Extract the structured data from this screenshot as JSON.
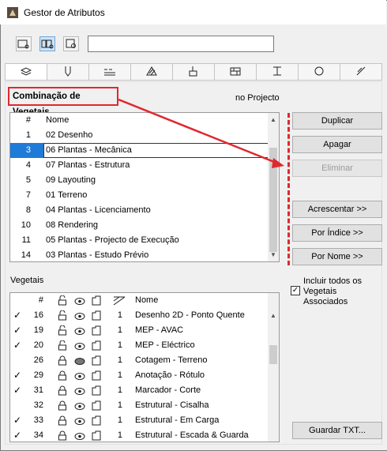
{
  "window": {
    "title": "Gestor de Atributos"
  },
  "toolbar": {
    "search_value": ""
  },
  "tabs": [
    "layers-icon",
    "pen-icon",
    "line-type-icon",
    "fill-icon",
    "paint-icon",
    "building-material-icon",
    "profile-icon",
    "surface-icon",
    "layer-combination-icon"
  ],
  "combination_label": "Combinação de Vegetais",
  "in_project_label": "no Projecto",
  "list1": {
    "headers": {
      "num": "#",
      "name": "Nome"
    },
    "rows": [
      {
        "num": "1",
        "name": "02 Desenho"
      },
      {
        "num": "3",
        "name": "06 Plantas - Mecânica",
        "selected": true
      },
      {
        "num": "4",
        "name": "07 Plantas - Estrutura"
      },
      {
        "num": "5",
        "name": "09 Layouting"
      },
      {
        "num": "7",
        "name": "01 Terreno"
      },
      {
        "num": "8",
        "name": "04 Plantas - Licenciamento"
      },
      {
        "num": "10",
        "name": "08 Rendering"
      },
      {
        "num": "11",
        "name": "05 Plantas - Projecto de Execução"
      },
      {
        "num": "14",
        "name": "03 Plantas - Estudo Prévio"
      }
    ]
  },
  "buttons": {
    "duplicate": "Duplicar",
    "delete": "Apagar",
    "eliminate": "Eliminar",
    "append": "Acrescentar >>",
    "by_index": "Por Índice >>",
    "by_name": "Por Nome >>",
    "save_txt": "Guardar TXT..."
  },
  "vegetais_label": "Vegetais",
  "include_all_label": "Incluir todos os Vegetais Associados",
  "list2": {
    "headers": {
      "num": "#",
      "name": "Nome"
    },
    "rows": [
      {
        "check": true,
        "num": "16",
        "lock": "open",
        "eye": "open",
        "pen": "1",
        "name": "Desenho 2D - Ponto Quente"
      },
      {
        "check": true,
        "num": "19",
        "lock": "open",
        "eye": "open",
        "pen": "1",
        "name": "MEP - AVAC"
      },
      {
        "check": true,
        "num": "20",
        "lock": "open",
        "eye": "open",
        "pen": "1",
        "name": "MEP - Eléctrico"
      },
      {
        "check": false,
        "num": "26",
        "lock": "closed",
        "eye": "closed",
        "pen": "1",
        "name": "Cotagem - Terreno"
      },
      {
        "check": true,
        "num": "29",
        "lock": "closed",
        "eye": "open",
        "pen": "1",
        "name": "Anotação - Rótulo"
      },
      {
        "check": true,
        "num": "31",
        "lock": "closed",
        "eye": "open",
        "pen": "1",
        "name": "Marcador - Corte"
      },
      {
        "check": false,
        "num": "32",
        "lock": "closed",
        "eye": "open",
        "pen": "1",
        "name": "Estrutural - Cisalha"
      },
      {
        "check": true,
        "num": "33",
        "lock": "closed",
        "eye": "open",
        "pen": "1",
        "name": "Estrutural - Em Carga"
      },
      {
        "check": true,
        "num": "34",
        "lock": "closed",
        "eye": "open",
        "pen": "1",
        "name": "Estrutural - Escada & Guarda"
      }
    ]
  },
  "colors": {
    "highlight": "#e0282e",
    "selection": "#1e7bd8"
  }
}
